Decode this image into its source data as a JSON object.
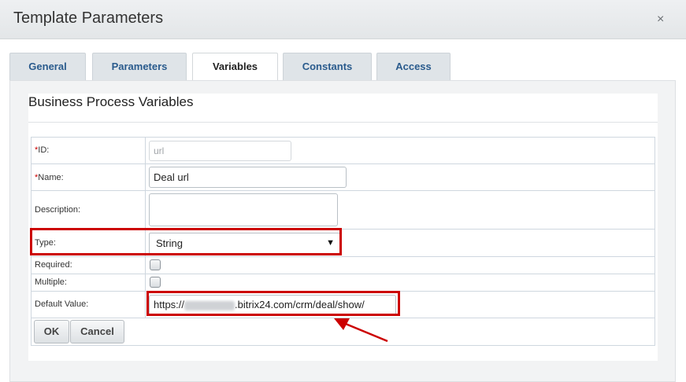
{
  "dialog": {
    "title": "Template Parameters",
    "close_label": "×"
  },
  "tabs": [
    {
      "label": "General",
      "active": false
    },
    {
      "label": "Parameters",
      "active": false
    },
    {
      "label": "Variables",
      "active": true
    },
    {
      "label": "Constants",
      "active": false
    },
    {
      "label": "Access",
      "active": false
    }
  ],
  "section": {
    "heading": "Business Process Variables"
  },
  "form": {
    "id": {
      "label": "ID:",
      "required_mark": "*",
      "value": "url",
      "disabled": true
    },
    "name": {
      "label": "Name:",
      "required_mark": "*",
      "value": "Deal url"
    },
    "description": {
      "label": "Description:",
      "value": ""
    },
    "type": {
      "label": "Type:",
      "selected": "String",
      "arrow": "▼"
    },
    "required": {
      "label": "Required:",
      "checked": false
    },
    "multiple": {
      "label": "Multiple:",
      "checked": false
    },
    "default_value": {
      "label": "Default Value:",
      "value_prefix": "https://",
      "value_suffix": ".bitrix24.com/crm/deal/show/"
    }
  },
  "buttons": {
    "ok": "OK",
    "cancel": "Cancel"
  },
  "colors": {
    "highlight": "#cc0000",
    "tab_text": "#2a5b8d"
  }
}
